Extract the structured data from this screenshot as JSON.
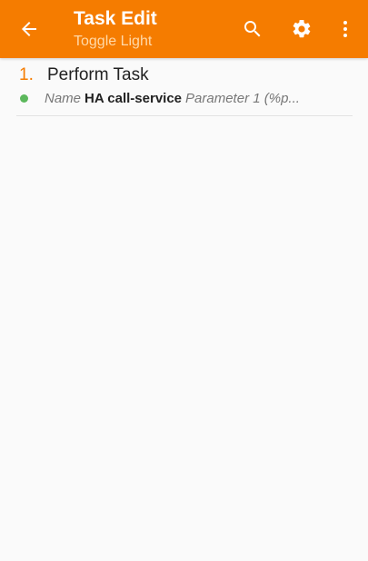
{
  "header": {
    "title": "Task Edit",
    "subtitle": "Toggle Light",
    "icons": {
      "back": "arrow-back-icon",
      "search": "search-icon",
      "settings": "gear-icon",
      "more": "more-vertical-icon"
    }
  },
  "actions": [
    {
      "number": "1.",
      "name": "Perform Task",
      "status_color": "#5cb85c",
      "param_label": "Name",
      "param_value": "HA call-service",
      "param_extra": "Parameter 1 (%p..."
    }
  ],
  "colors": {
    "accent": "#f57c00",
    "background": "#fafafa"
  }
}
